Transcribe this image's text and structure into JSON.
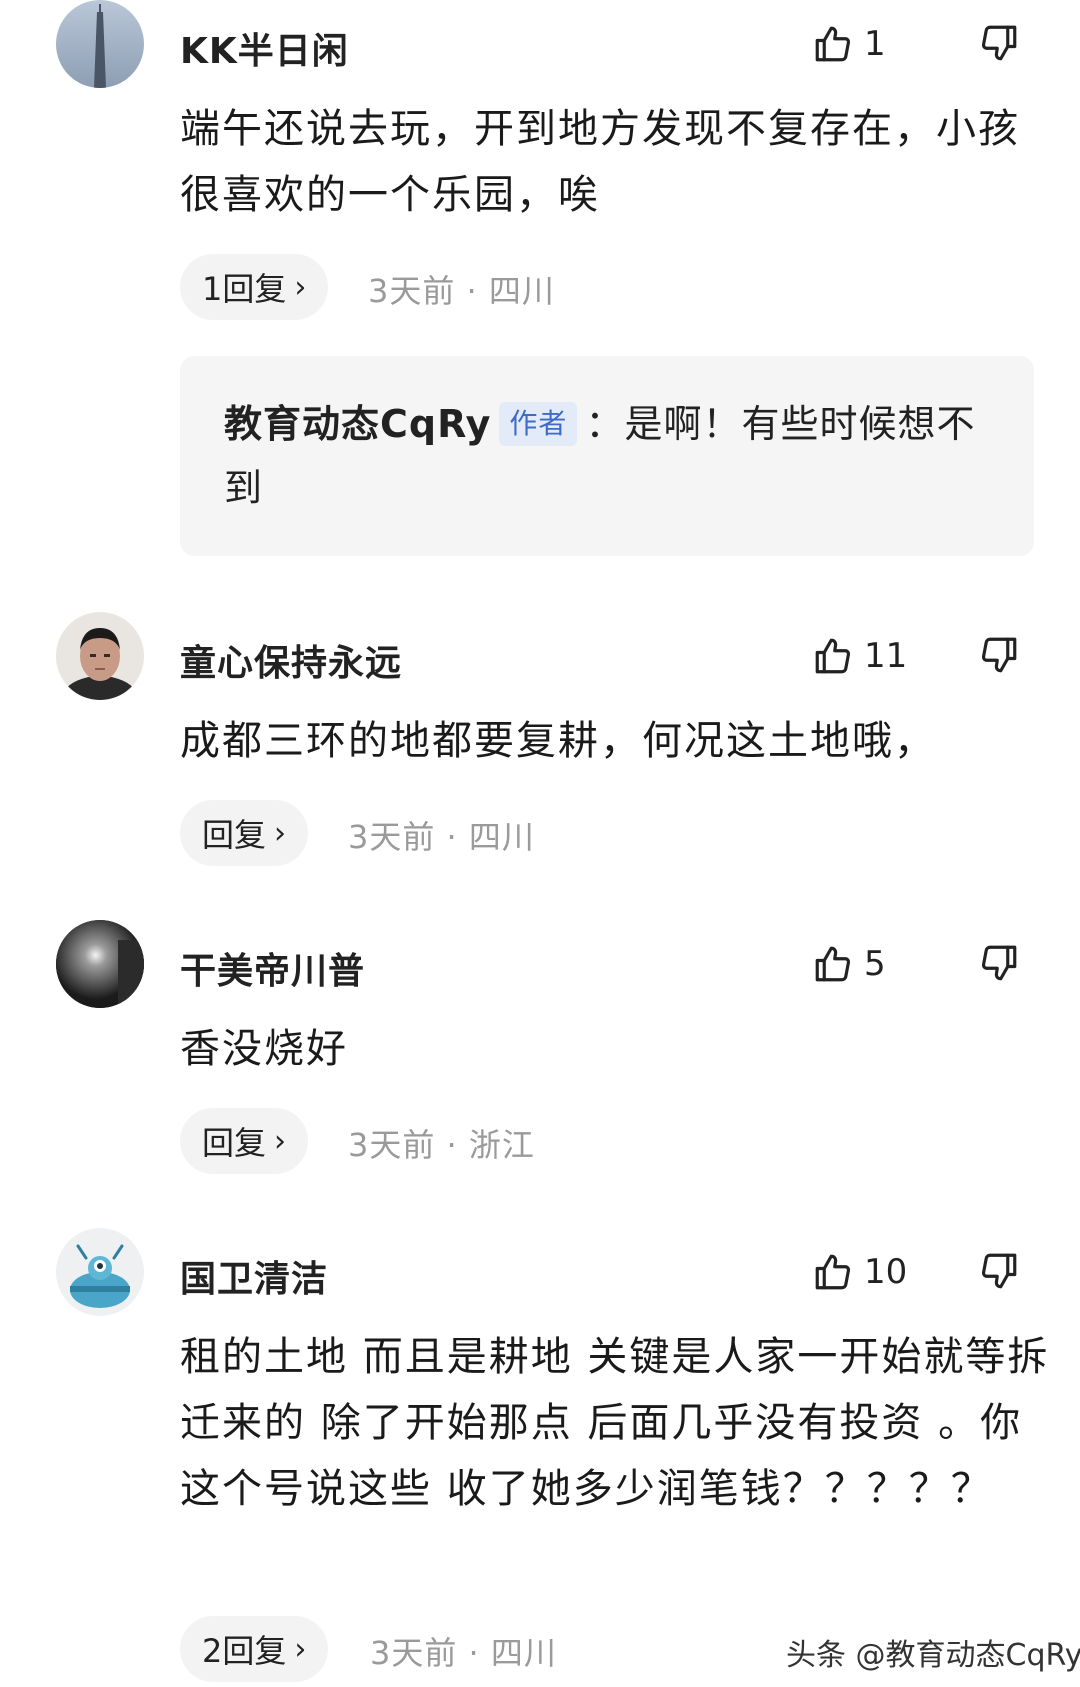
{
  "comments": [
    {
      "username": "KK半日闲",
      "likes": "1",
      "text": "端午还说去玩，开到地方发现不复存在，小孩很喜欢的一个乐园，唉",
      "reply_label": "1回复",
      "meta": "3天前 · 四川",
      "avatar": "tower-avatar",
      "author_reply": {
        "author": "教育动态CqRy",
        "badge": "作者",
        "text": "：是啊！有些时候想不到"
      }
    },
    {
      "username": "童心保持永远",
      "likes": "11",
      "text": "成都三环的地都要复耕，何况这土地哦，",
      "reply_label": "回复",
      "meta": "3天前 · 四川",
      "avatar": "person-avatar"
    },
    {
      "username": "干美帝川普",
      "likes": "5",
      "text": "香没烧好",
      "reply_label": "回复",
      "meta": "3天前 · 浙江",
      "avatar": "dark-photo-avatar"
    },
    {
      "username": "国卫清洁",
      "likes": "10",
      "text": "租的土地 而且是耕地 关键是人家一开始就等拆迁来的 除了开始那点 后面几乎没有投资 。你这个号说这些 收了她多少润笔钱？？？？？",
      "reply_label": "2回复",
      "meta": "3天前 · 四川",
      "avatar": "cartoon-avatar"
    }
  ],
  "icons": {
    "like": "thumbs-up-icon",
    "dislike": "thumbs-down-icon",
    "chevron": "›"
  },
  "colors": {
    "badge_bg": "#e4ebf8",
    "badge_text": "#3d6bc9",
    "meta_text": "#9a9a9a",
    "pill_bg": "#f3f3f4",
    "reply_box_bg": "#f5f5f6"
  },
  "watermark": "头条 @教育动态CqRy"
}
